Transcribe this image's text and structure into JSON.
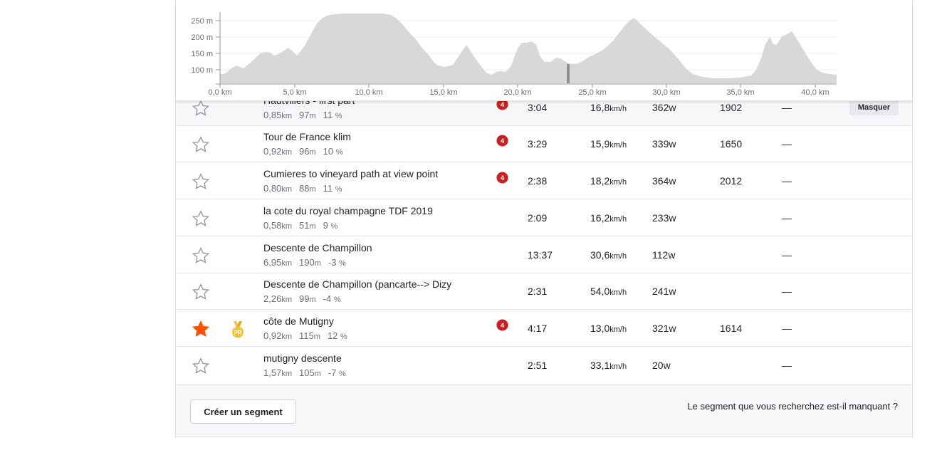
{
  "elevation_profile": {
    "y_ticks": [
      "250 m",
      "200 m",
      "150 m",
      "100 m"
    ],
    "x_ticks": [
      "0,0 km",
      "5,0 km",
      "10,0 km",
      "15,0 km",
      "20,0 km",
      "25,0 km",
      "30,0 km",
      "35,0 km",
      "40,0 km"
    ],
    "fill_color": "#d8d8d8",
    "marker_color": "#8f8f8f"
  },
  "segments": [
    {
      "name": "Hautvillers - first part",
      "distance": "0,85",
      "dist_unit": "km",
      "elevation": "97",
      "elev_unit": "m",
      "grade": "11",
      "grade_unit": "%",
      "category": "4",
      "time": "3:04",
      "speed": "16,8",
      "speed_unit": "km/h",
      "power": "362w",
      "vam": "1902",
      "dash": "—",
      "hide_label": "Masquer",
      "starred": false,
      "pr": false,
      "highlighted": true
    },
    {
      "name": "Tour de France klim",
      "distance": "0,92",
      "dist_unit": "km",
      "elevation": "96",
      "elev_unit": "m",
      "grade": "10",
      "grade_unit": "%",
      "category": "4",
      "time": "3:29",
      "speed": "15,9",
      "speed_unit": "km/h",
      "power": "339w",
      "vam": "1650",
      "dash": "—",
      "starred": false,
      "pr": false
    },
    {
      "name": "Cumieres to vineyard path at view point",
      "distance": "0,80",
      "dist_unit": "km",
      "elevation": "88",
      "elev_unit": "m",
      "grade": "11",
      "grade_unit": "%",
      "category": "4",
      "time": "2:38",
      "speed": "18,2",
      "speed_unit": "km/h",
      "power": "364w",
      "vam": "2012",
      "dash": "—",
      "starred": false,
      "pr": false
    },
    {
      "name": "la cote du royal champagne TDF 2019",
      "distance": "0,58",
      "dist_unit": "km",
      "elevation": "51",
      "elev_unit": "m",
      "grade": "9",
      "grade_unit": "%",
      "category": "",
      "time": "2:09",
      "speed": "16,2",
      "speed_unit": "km/h",
      "power": "233w",
      "vam": "",
      "dash": "—",
      "starred": false,
      "pr": false
    },
    {
      "name": "Descente de Champillon",
      "distance": "6,95",
      "dist_unit": "km",
      "elevation": "190",
      "elev_unit": "m",
      "grade": "-3",
      "grade_unit": "%",
      "category": "",
      "time": "13:37",
      "speed": "30,6",
      "speed_unit": "km/h",
      "power": "112w",
      "vam": "",
      "dash": "—",
      "starred": false,
      "pr": false
    },
    {
      "name": "Descente de Champillon (pancarte--> Dizy",
      "distance": "2,26",
      "dist_unit": "km",
      "elevation": "99",
      "elev_unit": "m",
      "grade": "-4",
      "grade_unit": "%",
      "category": "",
      "time": "2:31",
      "speed": "54,0",
      "speed_unit": "km/h",
      "power": "241w",
      "vam": "",
      "dash": "—",
      "starred": false,
      "pr": false
    },
    {
      "name": "côte de Mutigny",
      "distance": "0,92",
      "dist_unit": "km",
      "elevation": "115",
      "elev_unit": "m",
      "grade": "12",
      "grade_unit": "%",
      "category": "4",
      "time": "4:17",
      "speed": "13,0",
      "speed_unit": "km/h",
      "power": "321w",
      "vam": "1614",
      "dash": "—",
      "starred": true,
      "pr": true,
      "pr_label": "PR"
    },
    {
      "name": "mutigny descente",
      "distance": "1,57",
      "dist_unit": "km",
      "elevation": "105",
      "elev_unit": "m",
      "grade": "-7",
      "grade_unit": "%",
      "category": "",
      "time": "2:51",
      "speed": "33,1",
      "speed_unit": "km/h",
      "power": "20w",
      "vam": "",
      "dash": "—",
      "starred": false,
      "pr": false
    }
  ],
  "footer": {
    "create_label": "Créer un segment",
    "missing_label": "Le segment que vous recherchez est-il manquant ?"
  },
  "colors": {
    "star_active": "#fc5200",
    "star_inactive": "#9a9aa2",
    "category_badge": "#cc1f1f",
    "pr_medal": "#f2c23a"
  }
}
